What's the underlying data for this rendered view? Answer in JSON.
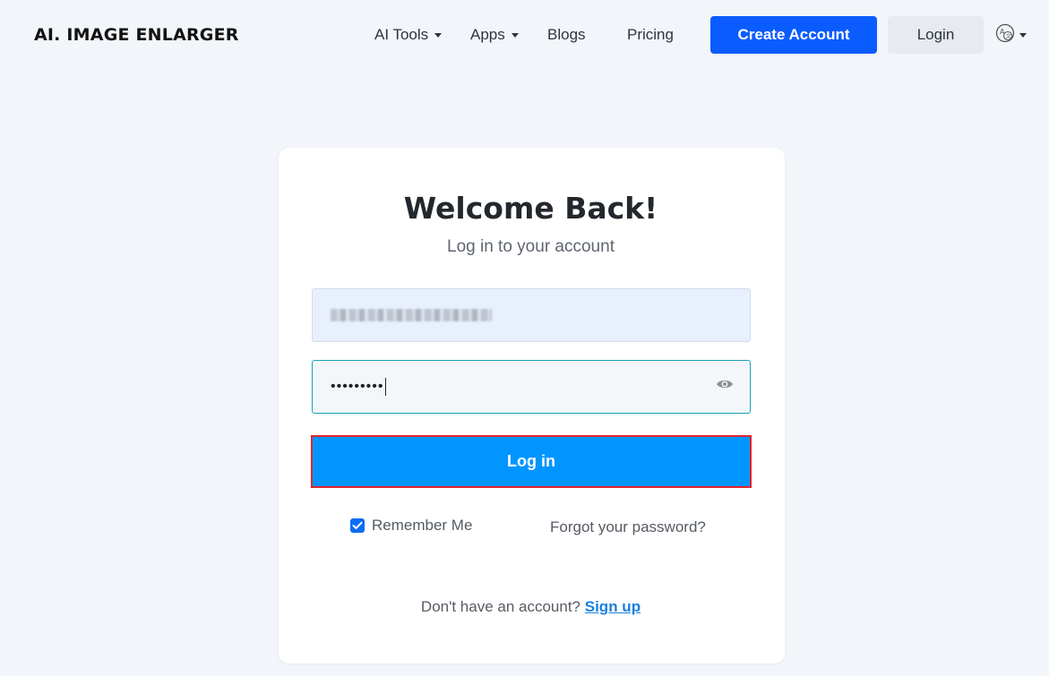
{
  "header": {
    "logo": "AI. IMAGE ENLARGER",
    "nav": {
      "ai_tools": "AI Tools",
      "apps": "Apps",
      "blogs": "Blogs",
      "pricing": "Pricing"
    },
    "create_account": "Create Account",
    "login": "Login",
    "language_icon": "translate-icon"
  },
  "card": {
    "title": "Welcome Back!",
    "subtitle": "Log in to your account",
    "email_value": "",
    "password_value": "•••••••••",
    "eye_icon": "eye-icon",
    "submit_label": "Log in",
    "remember_label": "Remember Me",
    "remember_checked": true,
    "forgot_label": "Forgot your password?",
    "no_account_text": "Don't have an account?",
    "signup_label": "Sign up"
  },
  "colors": {
    "background": "#f2f5f9",
    "primary": "#0b5cff",
    "submit": "#0095ff",
    "highlight_border": "#e0232e",
    "link": "#1a7fe0"
  }
}
